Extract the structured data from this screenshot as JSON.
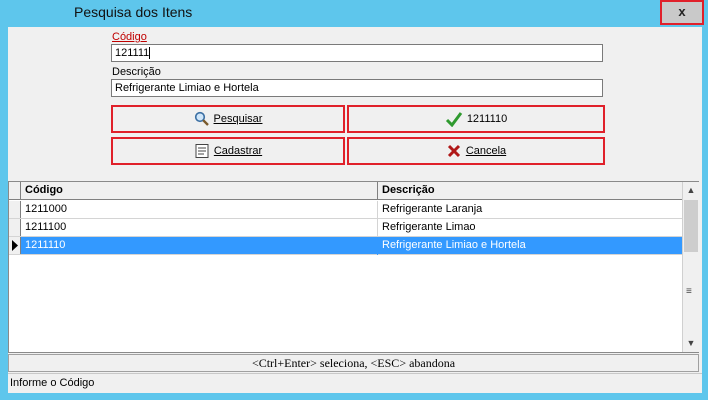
{
  "window": {
    "title": "Pesquisa dos Itens",
    "close_label": "x"
  },
  "form": {
    "codigo_label": "Código",
    "codigo_value": "121111",
    "descricao_label": "Descrição",
    "descricao_value": "Refrigerante Limiao e Hortela"
  },
  "buttons": {
    "pesquisar": "Pesquisar",
    "ok": "1211110",
    "cadastrar": "Cadastrar",
    "cancela": "Cancela"
  },
  "grid": {
    "columns": [
      "Código",
      "Descrição"
    ],
    "rows": [
      {
        "codigo": "1211000",
        "descricao": "Refrigerante Laranja"
      },
      {
        "codigo": "1211100",
        "descricao": "Refrigerante Limao"
      },
      {
        "codigo": "1211110",
        "descricao": "Refrigerante Limiao e Hortela"
      }
    ],
    "selected_index": 2
  },
  "hint": "<Ctrl+Enter> seleciona, <ESC> abandona",
  "status": "Informe o Código",
  "colors": {
    "title_bg": "#5ec6ec",
    "highlight_border": "#e0202a",
    "selection": "#3399ff",
    "label_red": "#c00000"
  },
  "icons": {
    "search": "magnifier-icon",
    "ok": "checkmark-icon",
    "register": "form-icon",
    "cancel": "x-icon"
  }
}
